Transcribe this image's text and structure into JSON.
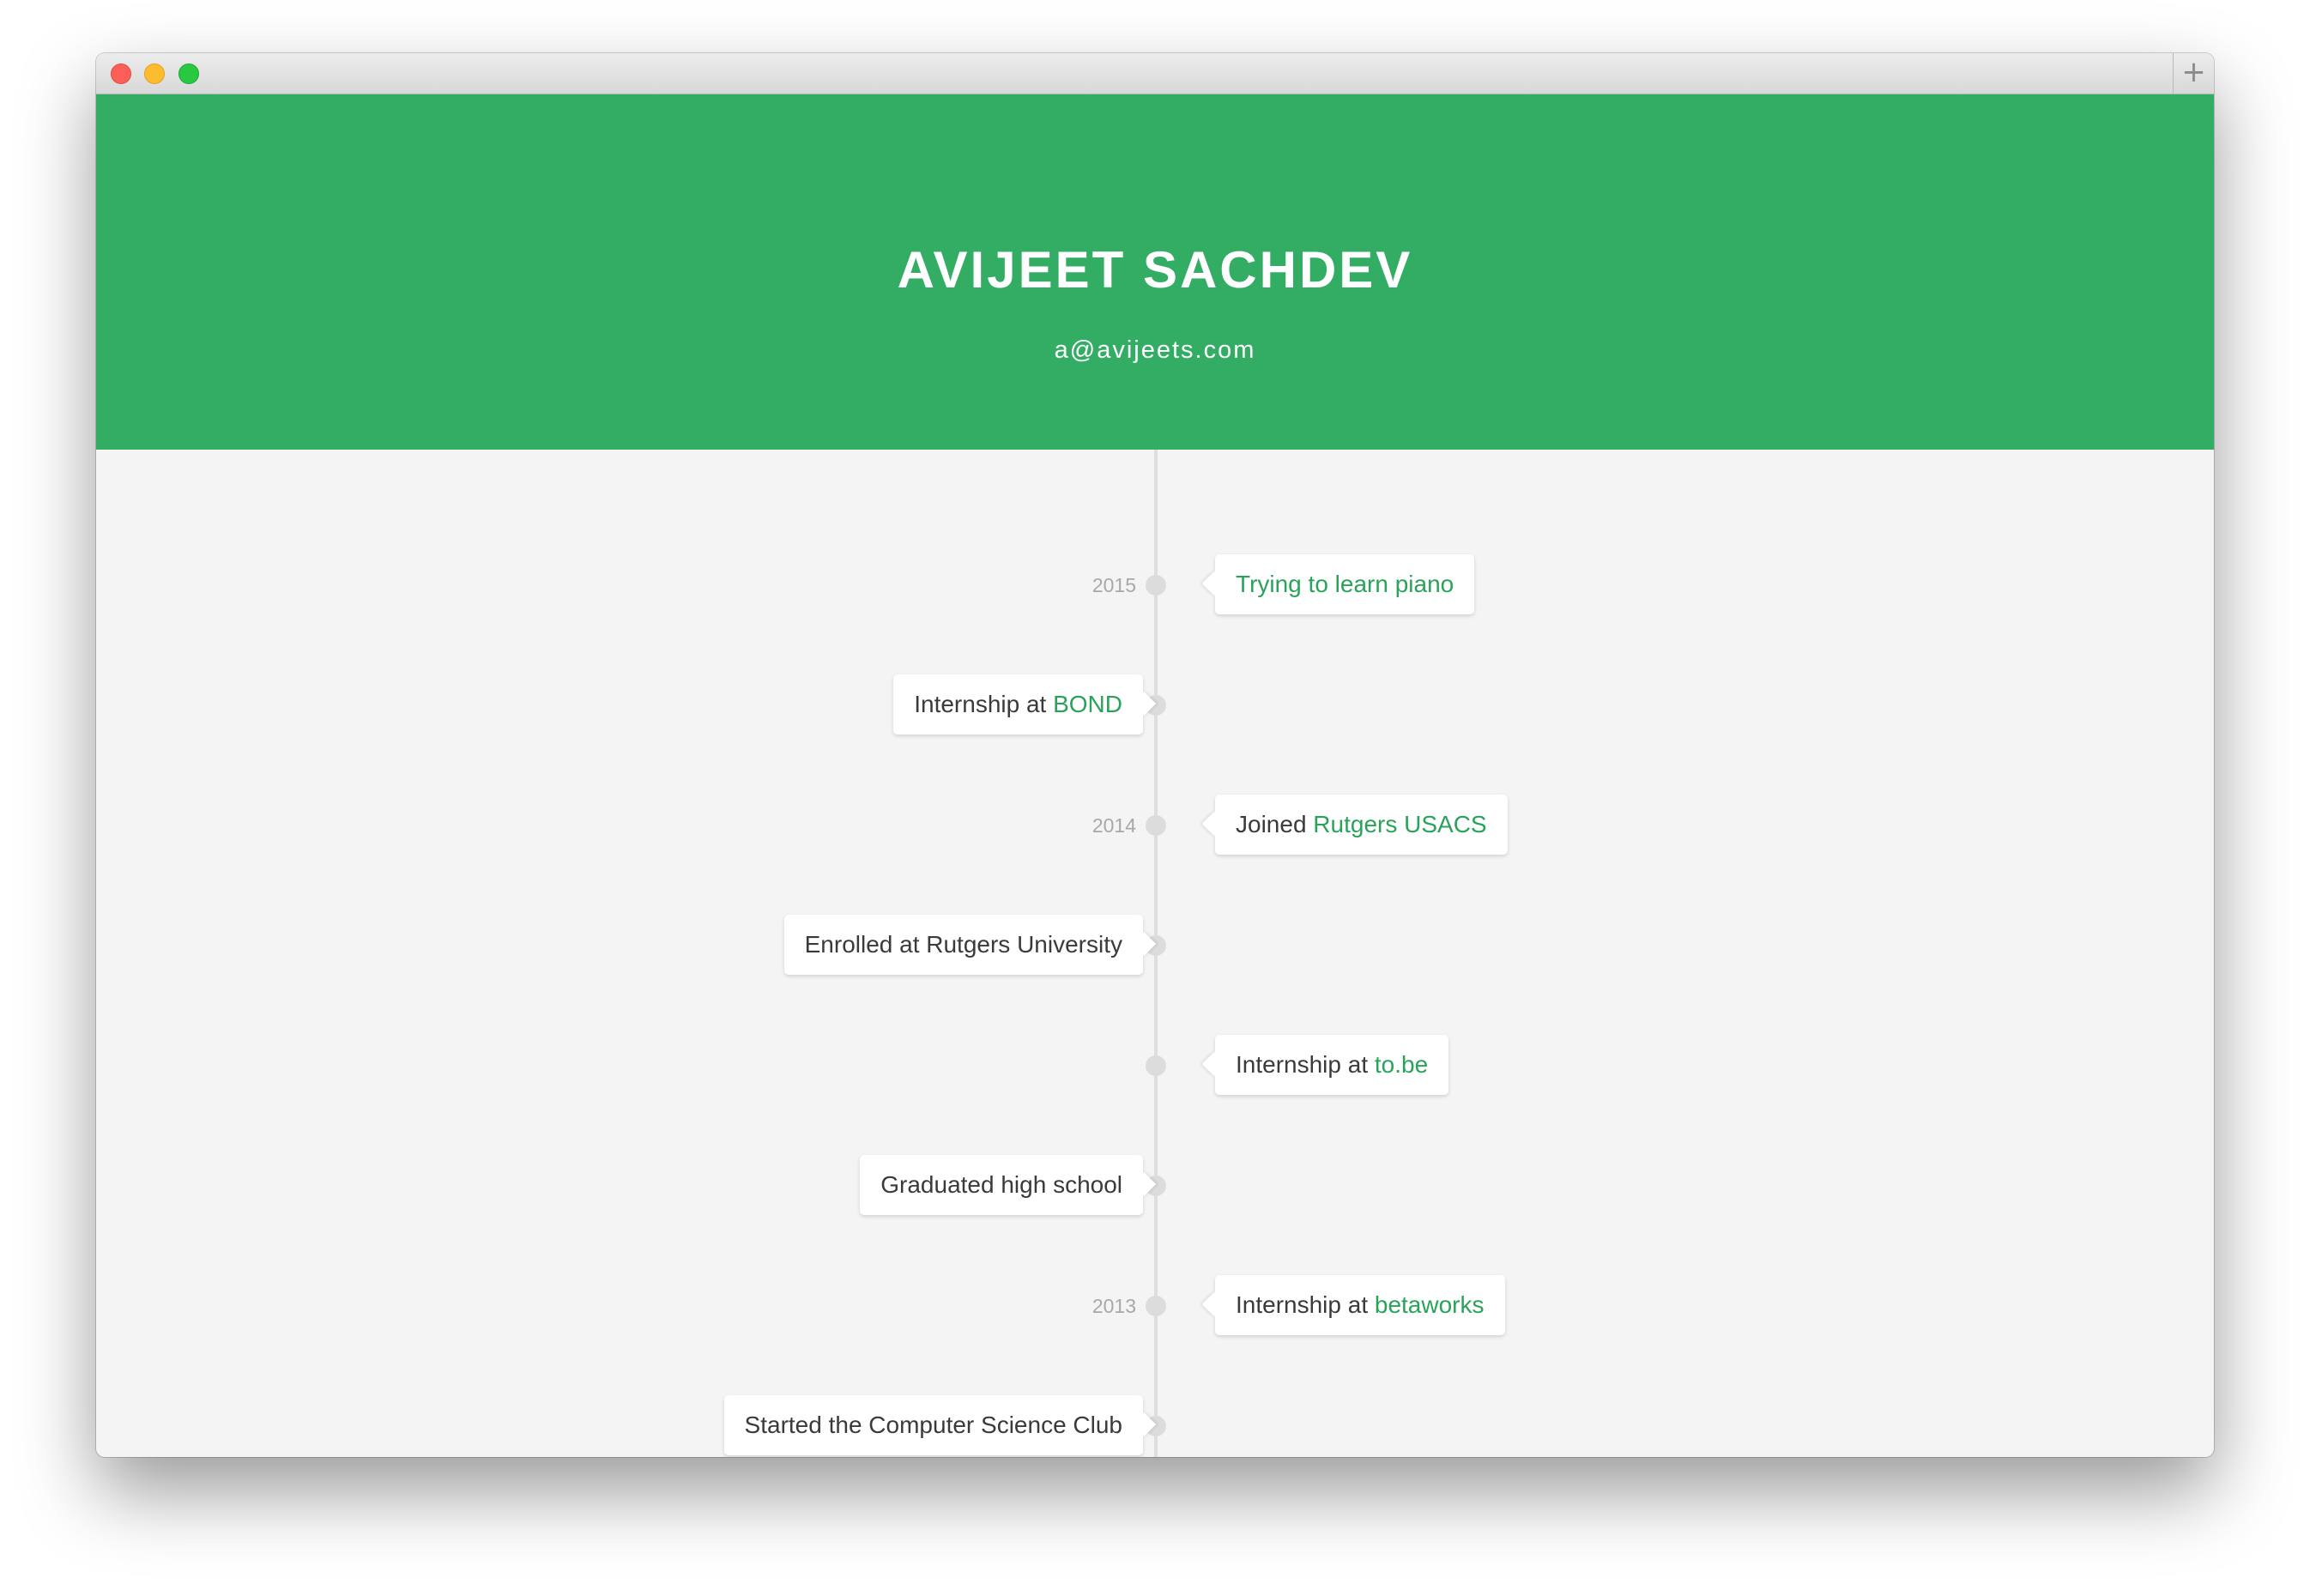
{
  "window": {
    "new_tab_symbol": "+",
    "traffic_lights": [
      "close",
      "minimize",
      "maximize"
    ]
  },
  "header": {
    "name": "AVIJEET SACHDEV",
    "email": "a@avijeets.com",
    "background_color": "#33ad64"
  },
  "timeline": {
    "accent_color": "#2aa35a",
    "entries": [
      {
        "side": "right",
        "year": "2015",
        "text": "",
        "link": "Trying to learn piano"
      },
      {
        "side": "left",
        "year": "",
        "text": "Internship at ",
        "link": "BOND"
      },
      {
        "side": "right",
        "year": "2014",
        "text": "Joined ",
        "link": "Rutgers USACS"
      },
      {
        "side": "left",
        "year": "",
        "text": "Enrolled at Rutgers University",
        "link": ""
      },
      {
        "side": "right",
        "year": "",
        "text": "Internship at ",
        "link": "to.be"
      },
      {
        "side": "left",
        "year": "",
        "text": "Graduated high school",
        "link": ""
      },
      {
        "side": "right",
        "year": "2013",
        "text": "Internship at ",
        "link": "betaworks"
      },
      {
        "side": "left",
        "year": "",
        "text": "Started the Computer Science Club",
        "link": ""
      }
    ]
  }
}
